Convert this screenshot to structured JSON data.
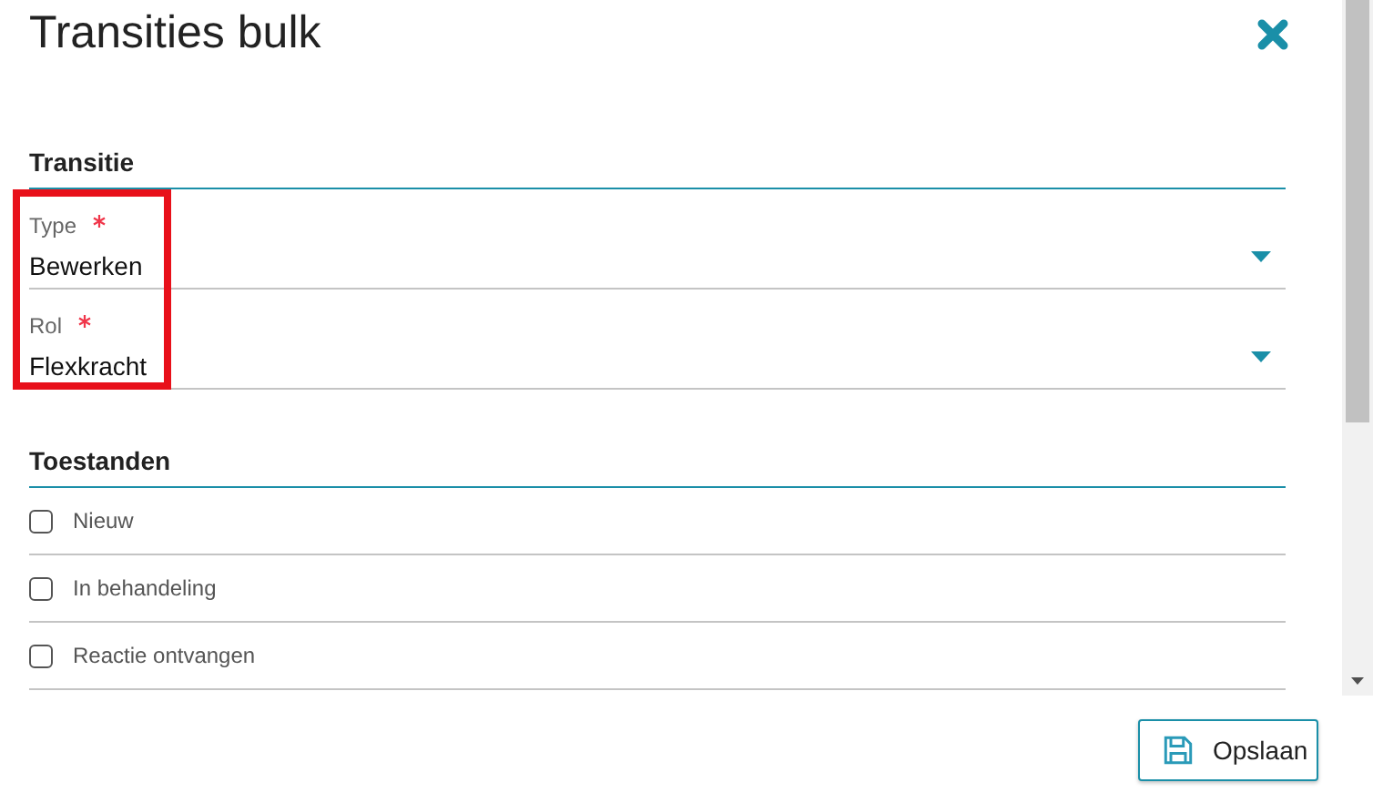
{
  "dialog": {
    "title": "Transities bulk"
  },
  "transitie": {
    "heading": "Transitie",
    "fields": [
      {
        "label": "Type",
        "required": true,
        "value": "Bewerken"
      },
      {
        "label": "Rol",
        "required": true,
        "value": "Flexkracht"
      }
    ]
  },
  "toestanden": {
    "heading": "Toestanden",
    "items": [
      {
        "label": "Nieuw",
        "checked": false
      },
      {
        "label": "In behandeling",
        "checked": false
      },
      {
        "label": "Reactie ontvangen",
        "checked": false
      }
    ]
  },
  "buttons": [
    {
      "label": "Opslaan"
    }
  ]
}
